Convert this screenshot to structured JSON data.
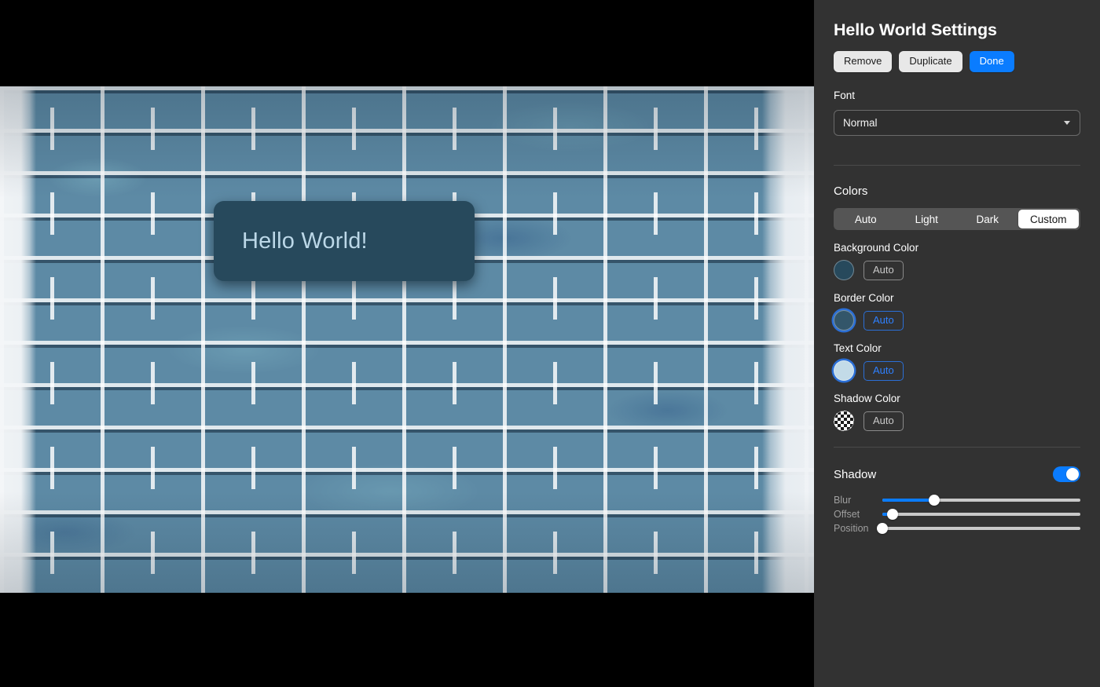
{
  "canvas": {
    "background_color": "#000000",
    "text_box": {
      "text": "Hello World!",
      "background_color": "#27495c",
      "text_color": "#bcd8e8",
      "border_color": "#27495c"
    }
  },
  "panel": {
    "title": "Hello World Settings",
    "background_color": "#323232",
    "actions": [
      {
        "label": "Remove",
        "style": "light"
      },
      {
        "label": "Duplicate",
        "style": "light"
      },
      {
        "label": "Done",
        "style": "primary"
      }
    ],
    "font": {
      "label": "Font",
      "selected": "Normal",
      "options": [
        "Normal"
      ]
    },
    "colors": {
      "label": "Colors",
      "modes": [
        "Auto",
        "Light",
        "Dark",
        "Custom"
      ],
      "selected_mode": "Custom",
      "rows": [
        {
          "label": "Background Color",
          "swatch": "#27495c",
          "swatch_type": "solid",
          "auto_label": "Auto",
          "auto_active": false
        },
        {
          "label": "Border Color",
          "swatch": "#33566a",
          "swatch_type": "solid",
          "auto_label": "Auto",
          "auto_active": true
        },
        {
          "label": "Text Color",
          "swatch": "#c3dbe8",
          "swatch_type": "solid",
          "auto_label": "Auto",
          "auto_active": true
        },
        {
          "label": "Shadow Color",
          "swatch": "transparent",
          "swatch_type": "checker",
          "auto_label": "Auto",
          "auto_active": false
        }
      ]
    },
    "shadow": {
      "label": "Shadow",
      "enabled": true,
      "sliders": [
        {
          "label": "Blur",
          "value": 26
        },
        {
          "label": "Offset",
          "value": 5
        },
        {
          "label": "Position",
          "value": 0
        }
      ]
    }
  },
  "accent_color": "#0a7cff"
}
